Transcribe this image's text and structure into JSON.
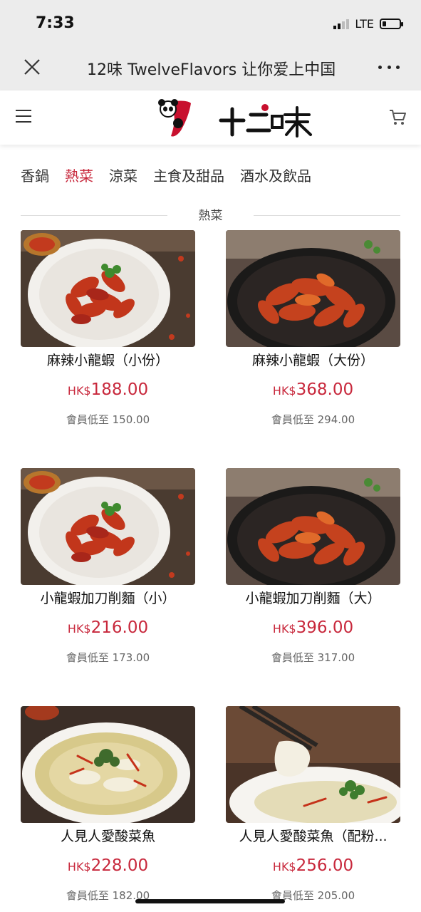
{
  "status_bar": {
    "time": "7:33",
    "network": "LTE"
  },
  "browser": {
    "title": "12味 TwelveFlavors 让你爱上中国"
  },
  "tabs": [
    "香鍋",
    "熱菜",
    "涼菜",
    "主食及甜品",
    "酒水及飲品"
  ],
  "active_tab": "熱菜",
  "section_title": "熱菜",
  "products": [
    {
      "name": "麻辣小龍蝦（小份）",
      "currency": "HK$",
      "price": "188.00",
      "member": "會員低至 150.00",
      "image": "crayfish-plate-icon"
    },
    {
      "name": "麻辣小龍蝦（大份）",
      "currency": "HK$",
      "price": "368.00",
      "member": "會員低至 294.00",
      "image": "crayfish-bowl-icon"
    },
    {
      "name": "小龍蝦加刀削麵（小）",
      "currency": "HK$",
      "price": "216.00",
      "member": "會員低至 173.00",
      "image": "crayfish-plate-icon"
    },
    {
      "name": "小龍蝦加刀削麵（大）",
      "currency": "HK$",
      "price": "396.00",
      "member": "會員低至 317.00",
      "image": "crayfish-bowl-icon"
    },
    {
      "name": "人見人愛酸菜魚",
      "currency": "HK$",
      "price": "228.00",
      "member": "會員低至 182.00",
      "image": "fish-soup-icon"
    },
    {
      "name": "人見人愛酸菜魚（配粉...",
      "currency": "HK$",
      "price": "256.00",
      "member": "會員低至 205.00",
      "image": "fish-chopsticks-icon"
    }
  ],
  "colors": {
    "accent": "#c8283c",
    "header_bg": "#ececec"
  }
}
